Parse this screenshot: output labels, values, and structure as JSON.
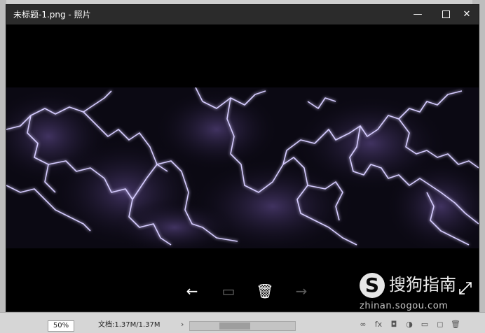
{
  "window": {
    "title": "未标题-1.png - 照片",
    "minimize": "—",
    "close": "✕"
  },
  "toolbar": {
    "back_glyph": "←",
    "slideshow_glyph": "▭",
    "delete_glyph": "🗑",
    "forward_glyph": "→"
  },
  "status": {
    "zoom": "50%",
    "doc_info": "文档:1.37M/1.37M",
    "arrow": "›"
  },
  "layer_icons": [
    "∞",
    "fx",
    "◘",
    "◑",
    "▭",
    "◻",
    "🗑"
  ],
  "watermark": {
    "logo_letter": "S",
    "brand": "搜狗指南",
    "url": "zhinan.sogou.com"
  },
  "colors": {
    "viewer_bg": "#000000",
    "titlebar_bg": "#2b2b2b",
    "lightning": "#c8b8ff"
  }
}
